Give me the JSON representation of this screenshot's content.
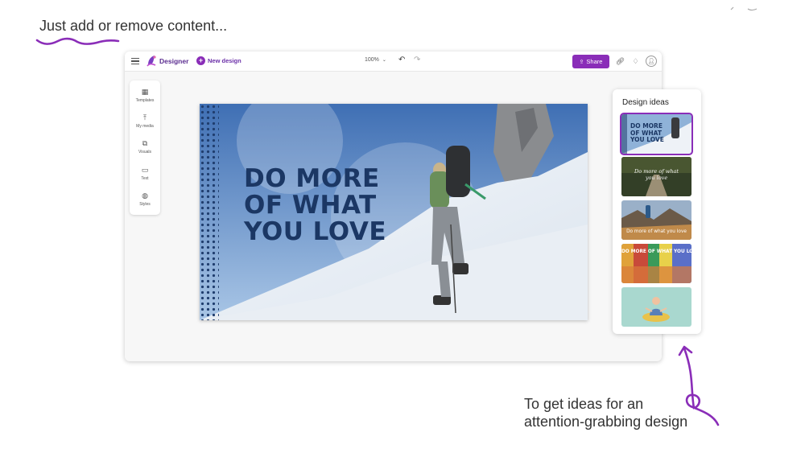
{
  "captions": {
    "top": "Just add or remove content...",
    "bottom_line1": "To get ideas for an",
    "bottom_line2": "attention-grabbing design"
  },
  "topbar": {
    "brand": "Designer",
    "new_design": "New design",
    "zoom": "100%",
    "share": "Share"
  },
  "leftrail": {
    "items": [
      {
        "label": "Templates",
        "icon": "templates-icon"
      },
      {
        "label": "My media",
        "icon": "upload-icon"
      },
      {
        "label": "Visuals",
        "icon": "shapes-icon"
      },
      {
        "label": "Text",
        "icon": "text-icon"
      },
      {
        "label": "Styles",
        "icon": "palette-icon"
      }
    ]
  },
  "canvas": {
    "headline": [
      "DO MORE",
      "OF WHAT",
      "YOU LOVE"
    ]
  },
  "design_ideas": {
    "title": "Design ideas",
    "thumb1_text": [
      "DO MORE",
      "OF WHAT",
      "YOU LOVE"
    ],
    "thumb2_text": [
      "Do more of what",
      "you love"
    ],
    "thumb3_text": "Do more of what you love",
    "thumb4_text": "DO MORE OF WHAT YOU LOVE"
  },
  "colors": {
    "accent": "#8a2db8",
    "brand": "#5b2d90",
    "headline": "#1b3764"
  }
}
